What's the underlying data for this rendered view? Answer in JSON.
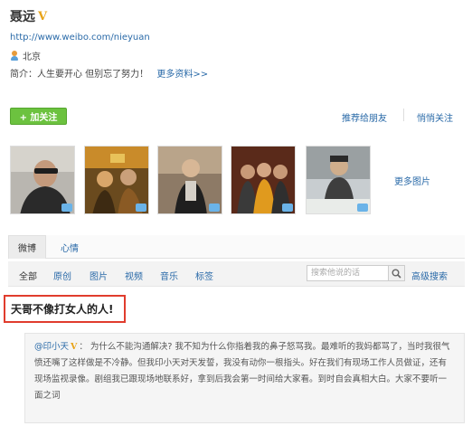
{
  "profile": {
    "name": "聂远",
    "verified_mark": "V",
    "url": "http://www.weibo.com/nieyuan",
    "location": "北京",
    "bio_prefix": "简介：",
    "bio": "人生要开心 但别忘了努力！",
    "more_info": "更多资料>>"
  },
  "actions": {
    "follow": "+ 加关注",
    "recommend": "推荐给朋友",
    "quiet_follow": "悄悄关注"
  },
  "photos": {
    "more": "更多图片",
    "count": 5
  },
  "tabs": [
    {
      "label": "微博",
      "active": true
    },
    {
      "label": "心情",
      "active": false
    }
  ],
  "filters": [
    {
      "label": "全部",
      "current": true
    },
    {
      "label": "原创",
      "current": false
    },
    {
      "label": "图片",
      "current": false
    },
    {
      "label": "视频",
      "current": false
    },
    {
      "label": "音乐",
      "current": false
    },
    {
      "label": "标签",
      "current": false
    }
  ],
  "search": {
    "placeholder": "搜索他说的话",
    "advanced": "高级搜索"
  },
  "post": {
    "title": "天哥不像打女人的人!"
  },
  "repost": {
    "author": "@印小天",
    "verified_mark": "V",
    "text": "： 为什么不能沟通解决? 我不知为什么你指着我的鼻子怒骂我。最难听的我妈都骂了，当时我很气愤还嘴了这样做是不冷静。但我印小天对天发誓，我没有动你一根指头。好在我们有现场工作人员做证，还有现场监视录像。剧组我已跟现场地联系好，拿到后我会第一时间给大家看。到时自会真相大白。大家不要听一面之词"
  },
  "colors": {
    "link": "#2a6aa8",
    "follow_button": "#6cc23f",
    "highlight_border": "#e03c2d",
    "verified": "#e8a317"
  }
}
